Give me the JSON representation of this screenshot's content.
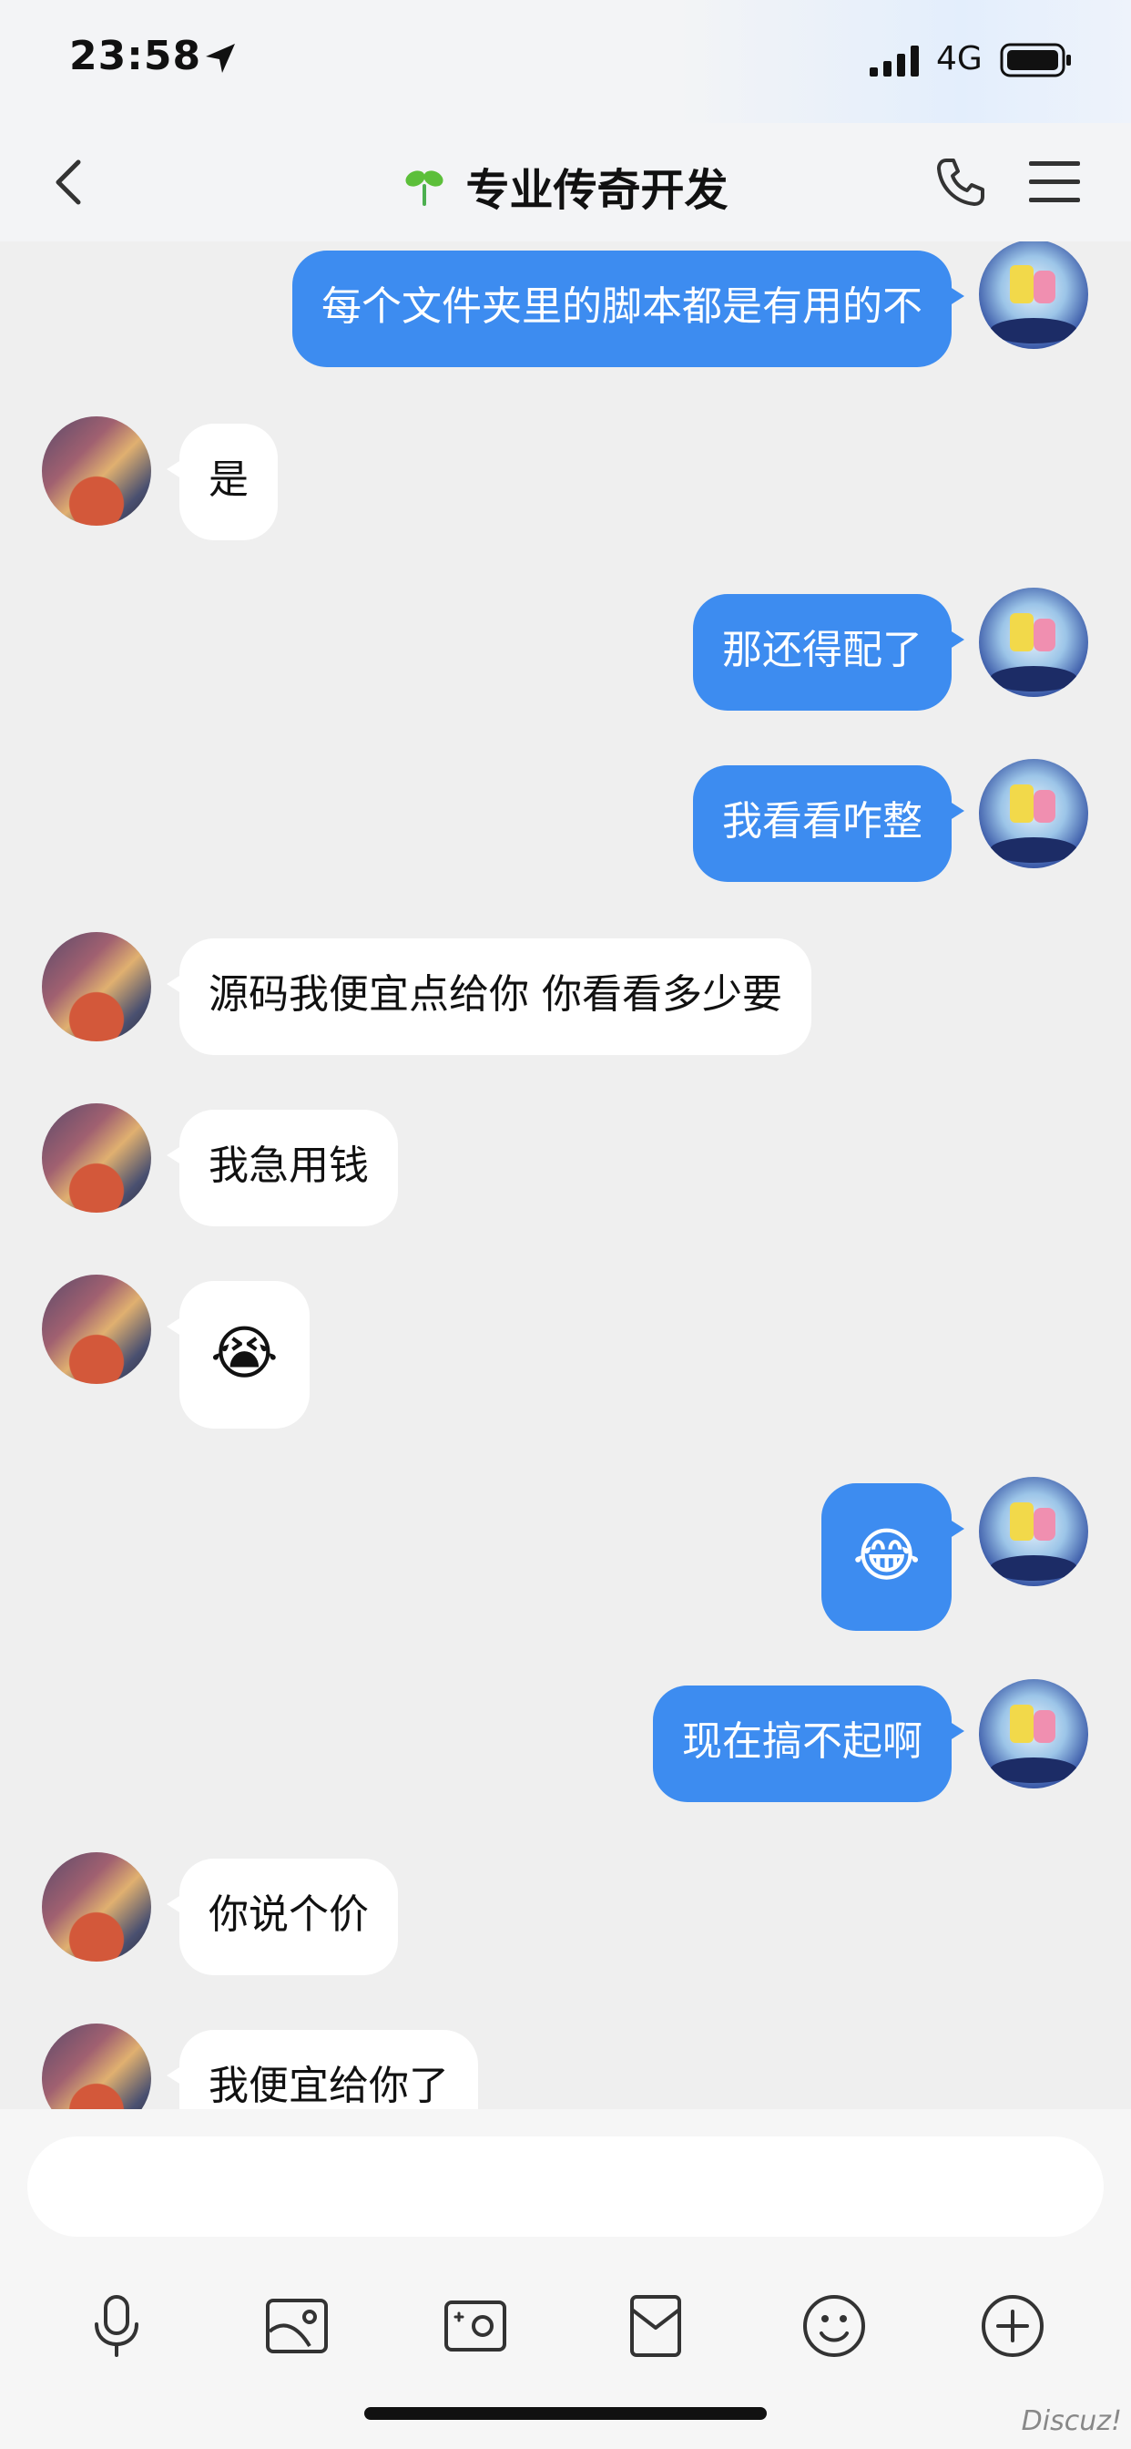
{
  "status_bar": {
    "time": "23:58",
    "network": "4G"
  },
  "header": {
    "title": "专业传奇开发"
  },
  "messages": [
    {
      "side": "me",
      "text": "每个文件夹里的脚本都是有用的不"
    },
    {
      "side": "other",
      "text": "是"
    },
    {
      "side": "me",
      "text": "那还得配了"
    },
    {
      "side": "me",
      "text": "我看看咋整"
    },
    {
      "side": "other",
      "text": "源码我便宜点给你 你看看多少要"
    },
    {
      "side": "other",
      "text": "我急用钱"
    },
    {
      "side": "other",
      "text": "😭"
    },
    {
      "side": "me",
      "text": "😂"
    },
    {
      "side": "me",
      "text": "现在搞不起啊"
    },
    {
      "side": "other",
      "text": "你说个价"
    },
    {
      "side": "other",
      "text": "我便宜给你了"
    }
  ],
  "composer": {
    "value": "",
    "placeholder": ""
  },
  "watermark": "Discuz!",
  "colors": {
    "my_bubble": "#3d8cf0",
    "other_bubble": "#ffffff",
    "background": "#efefef"
  }
}
